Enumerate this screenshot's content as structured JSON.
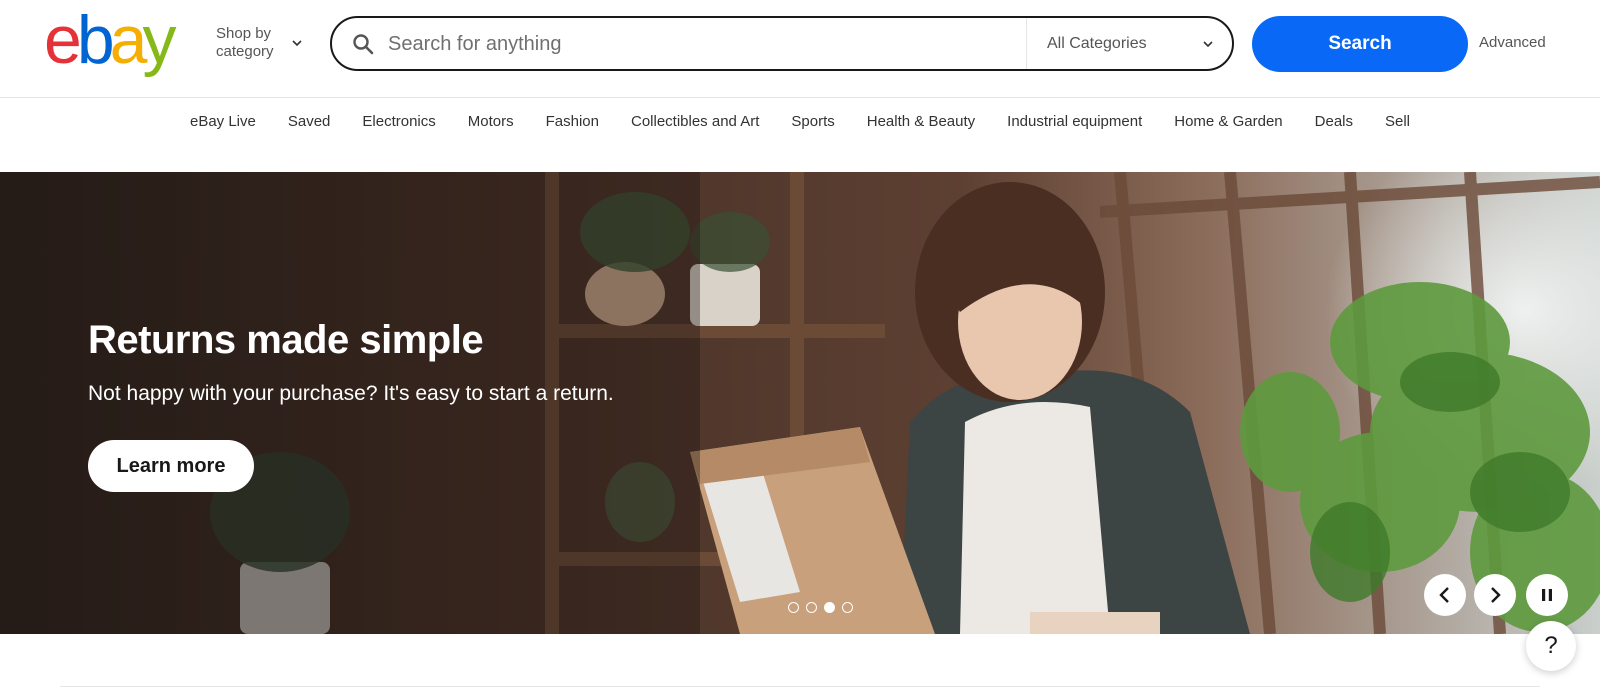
{
  "logo": {
    "letters": [
      "e",
      "b",
      "a",
      "y"
    ],
    "colors": [
      "#e53238",
      "#0064d2",
      "#f5af02",
      "#86b817"
    ]
  },
  "header": {
    "shop_by_category": "Shop by category",
    "search_placeholder": "Search for anything",
    "category_select": "All Categories",
    "search_button": "Search",
    "advanced_link": "Advanced"
  },
  "nav": {
    "items": [
      "eBay Live",
      "Saved",
      "Electronics",
      "Motors",
      "Fashion",
      "Collectibles and Art",
      "Sports",
      "Health & Beauty",
      "Industrial equipment",
      "Home & Garden",
      "Deals",
      "Sell"
    ]
  },
  "hero": {
    "title": "Returns made simple",
    "subtitle": "Not happy with your purchase? It's easy to start a return.",
    "button": "Learn more",
    "slide_count": 4,
    "active_slide": 3
  },
  "controls": {
    "prev_icon": "chevron-left-icon",
    "next_icon": "chevron-right-icon",
    "pause_icon": "pause-icon"
  },
  "help": {
    "label": "?"
  },
  "colors": {
    "accent": "#0968f6",
    "text": "#191919"
  }
}
